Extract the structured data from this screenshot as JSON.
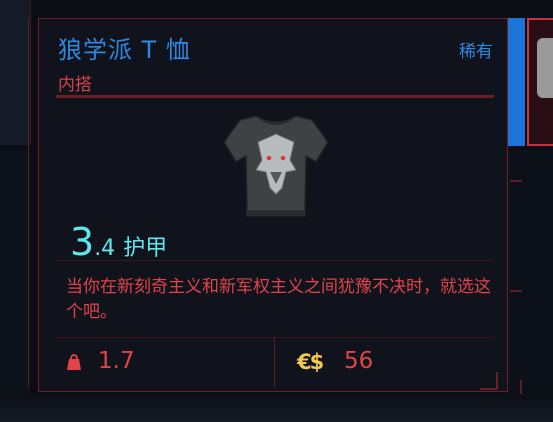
{
  "tooltip": {
    "title": "狼学派 T 恤",
    "rarity": "稀有",
    "item_type": "内搭",
    "armor": {
      "value_int": "3",
      "value_dec": ".4",
      "label": "护甲"
    },
    "description": "当你在新刻奇主义和新军权主义之间犹豫不决时，就选这个吧。",
    "weight": "1.7",
    "price_currency": "€$",
    "price": "56",
    "icons": {
      "weight": "weight-bag-icon",
      "currency": "eurodollar-icon",
      "item": "tshirt-icon"
    },
    "colors": {
      "rarity_blue": "#2f88e0",
      "accent_red": "#e04448",
      "armor_cyan": "#5ee8ec",
      "currency_yellow": "#f2c94c",
      "border_red": "#6b1f29"
    }
  }
}
